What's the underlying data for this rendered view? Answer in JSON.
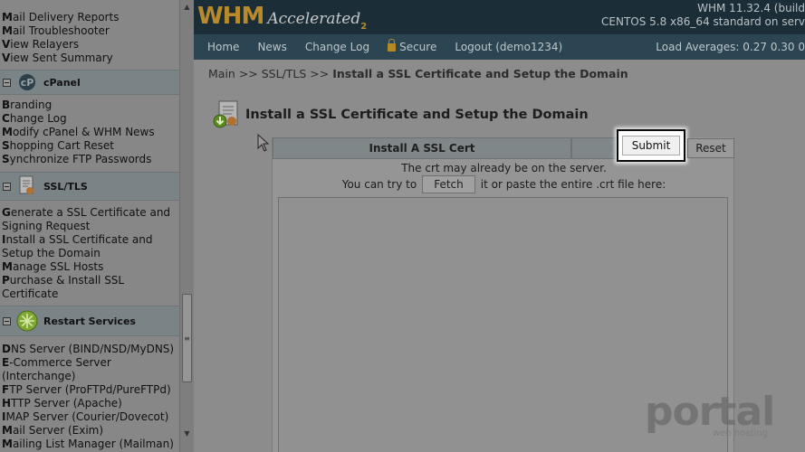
{
  "sidebar": {
    "top_links": [
      {
        "first": "M",
        "rest": "ail Delivery Reports"
      },
      {
        "first": "M",
        "rest": "ail Troubleshooter"
      },
      {
        "first": "V",
        "rest": "iew Relayers"
      },
      {
        "first": "V",
        "rest": "iew Sent Summary"
      }
    ],
    "cpanel": {
      "title": "cPanel",
      "links": [
        {
          "first": "B",
          "rest": "randing"
        },
        {
          "first": "C",
          "rest": "hange Log"
        },
        {
          "first": "M",
          "rest": "odify cPanel & WHM News"
        },
        {
          "first": "S",
          "rest": "hopping Cart Reset"
        },
        {
          "first": "S",
          "rest": "ynchronize FTP Passwords"
        }
      ]
    },
    "ssl": {
      "title": "SSL/TLS",
      "links": [
        {
          "first": "G",
          "rest": "enerate a SSL Certificate and"
        },
        {
          "first": "",
          "rest": "Signing Request"
        },
        {
          "first": "I",
          "rest": "nstall a SSL Certificate and"
        },
        {
          "first": "",
          "rest": "Setup the Domain"
        },
        {
          "first": "M",
          "rest": "anage SSL Hosts"
        },
        {
          "first": "P",
          "rest": "urchase & Install SSL"
        },
        {
          "first": "",
          "rest": "Certificate"
        }
      ]
    },
    "restart": {
      "title": "Restart Services",
      "links": [
        {
          "first": "D",
          "rest": "NS Server (BIND/NSD/MyDNS)"
        },
        {
          "first": "E",
          "rest": "-Commerce Server"
        },
        {
          "first": "",
          "rest": "(Interchange)"
        },
        {
          "first": "F",
          "rest": "TP Server (ProFTPd/PureFTPd)"
        },
        {
          "first": "H",
          "rest": "TTP Server (Apache)"
        },
        {
          "first": "I",
          "rest": "MAP Server (Courier/Dovecot)"
        },
        {
          "first": "M",
          "rest": "ail Server (Exim)"
        },
        {
          "first": "M",
          "rest": "ailing List Manager (Mailman)"
        }
      ]
    }
  },
  "header": {
    "logo_main": "WHM",
    "logo_accel": "Accelerated",
    "logo_sub": "2",
    "version_line1": "WHM 11.32.4 (build",
    "version_line2": "CENTOS 5.8 x86_64 standard on serv"
  },
  "nav": {
    "home": "Home",
    "news": "News",
    "changelog": "Change Log",
    "secure": "Secure",
    "logout": "Logout (demo1234)",
    "loads": "Load Averages: 0.27 0.30 0"
  },
  "breadcrumb": {
    "path": "Main >> SSL/TLS >> ",
    "current": "Install a SSL Certificate and Setup the Domain"
  },
  "page": {
    "title": "Install a SSL Certificate and Setup the Domain"
  },
  "form": {
    "header": "Install A SSL Cert",
    "submit_label": "Submit",
    "reset_label": "Reset",
    "note1": "The crt may already be on the server.",
    "note2_pre": "You can try to",
    "fetch_label": "Fetch",
    "note2_post": "it or paste the entire .crt file here:",
    "crt_value": ""
  },
  "watermark": {
    "main": "portal",
    "sub": "web hosting"
  },
  "colors": {
    "topbar": "#1b2d36",
    "navbar": "#2b4652",
    "logo_gold": "#b88a2a"
  }
}
